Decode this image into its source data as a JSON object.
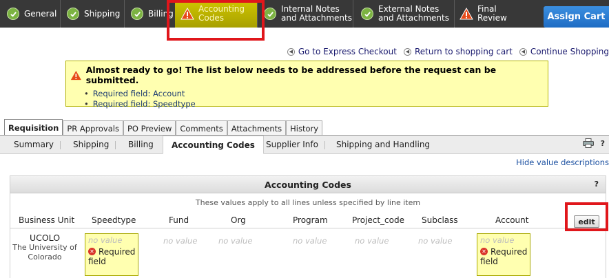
{
  "steps": [
    {
      "label": "General",
      "status": "complete"
    },
    {
      "label": "Shipping",
      "status": "complete"
    },
    {
      "label": "Billing",
      "status": "complete"
    },
    {
      "line1": "Accounting",
      "line2": "Codes",
      "status": "warning"
    },
    {
      "line1": "Internal Notes",
      "line2": "and Attachments",
      "status": "complete"
    },
    {
      "line1": "External Notes",
      "line2": "and Attachments",
      "status": "complete"
    },
    {
      "line1": "Final",
      "line2": "Review",
      "status": "warning"
    }
  ],
  "assign_cart_label": "Assign Cart",
  "links": {
    "express_checkout": "Go to Express Checkout",
    "return_cart": "Return to shopping cart",
    "continue_shopping": "Continue Shopping"
  },
  "alert": {
    "title": "Almost ready to go! The list below needs to be addressed before the request can be submitted.",
    "items": [
      "Required field: Account",
      "Required field: Speedtype"
    ]
  },
  "tabs": [
    "Requisition",
    "PR Approvals",
    "PO Preview",
    "Comments",
    "Attachments",
    "History"
  ],
  "subtabs": [
    "Summary",
    "Shipping",
    "Billing",
    "Accounting Codes",
    "Supplier Info",
    "Shipping and Handling"
  ],
  "help_mark": "?",
  "hide_descriptions": "Hide value descriptions",
  "panel": {
    "title": "Accounting Codes",
    "note": "These values apply to all lines unless specified by line item",
    "columns": [
      "Business Unit",
      "Speedtype",
      "Fund",
      "Org",
      "Program",
      "Project_code",
      "Subclass",
      "Account"
    ],
    "edit_label": "edit",
    "business_unit": {
      "code": "UCOLO",
      "desc_line1": "The University of",
      "desc_line2": "Colorado"
    },
    "no_value": "no value",
    "required_label_1": "Required",
    "required_label_2": "field"
  },
  "colors": {
    "active_step": "#b8b000",
    "highlight_red": "#e0161b",
    "assign_blue": "#1e6cc4",
    "alert_bg": "#ffffb0"
  }
}
